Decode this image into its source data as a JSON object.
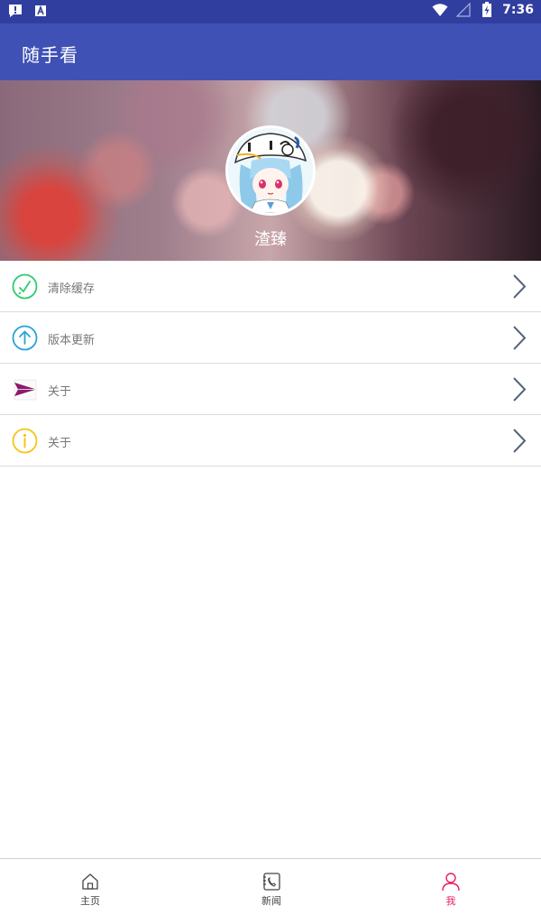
{
  "status_bar": {
    "time": "7:36",
    "left_icons": [
      "alert-icon",
      "text-a-icon"
    ],
    "right_icons": [
      "wifi-icon",
      "signal-icon",
      "battery-icon"
    ]
  },
  "app_bar": {
    "title": "随手看"
  },
  "profile": {
    "username": "渣臻",
    "avatar": "anime-avatar"
  },
  "menu": [
    {
      "label": "清除缓存",
      "icon": "broom-icon",
      "color": "#2ecc71"
    },
    {
      "label": "版本更新",
      "icon": "arrow-up-circle-icon",
      "color": "#29a3d9"
    },
    {
      "label": "关于",
      "icon": "paper-plane-icon",
      "color": "#8b1a6b"
    },
    {
      "label": "关于",
      "icon": "info-circle-icon",
      "color": "#f5c518"
    }
  ],
  "bottom_nav": {
    "items": [
      {
        "label": "主页",
        "icon": "home-icon"
      },
      {
        "label": "新闻",
        "icon": "phone-book-icon"
      },
      {
        "label": "我",
        "icon": "person-icon"
      }
    ],
    "active": "我",
    "active_color": "#e91e63"
  },
  "colors": {
    "status_bar": "#303f9f",
    "app_bar": "#3f51b5"
  }
}
